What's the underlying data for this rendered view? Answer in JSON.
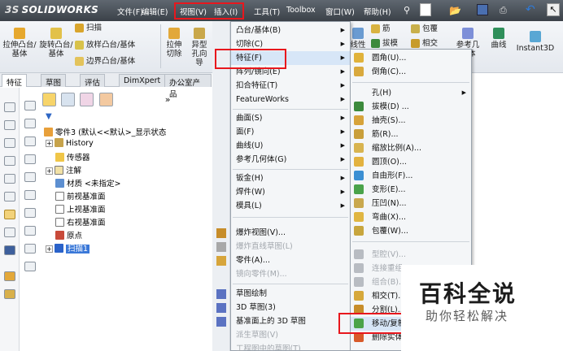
{
  "app": {
    "logo_prefix": "3S",
    "logo_name": "SOLIDWORKS"
  },
  "menubar": {
    "items": [
      "文件(F)",
      "编辑(E)",
      "视图(V)",
      "插入(I)",
      "工具(T)",
      "Toolbox",
      "窗口(W)",
      "帮助(H)"
    ]
  },
  "ribbon": {
    "extrude_boss": "拉伸凸台/基体",
    "revolve_boss": "旋转凸台/基体",
    "sweep": "扫描",
    "loft": "放样凸台/基体",
    "boundary": "边界凸台/基体",
    "extrude_cut": "拉伸切除",
    "hole_wizard": "异型孔向导",
    "linear_pattern": "线性阵列",
    "rib": "筋",
    "wrap": "包覆",
    "draft": "拔模",
    "intersect": "相交",
    "ref_geometry": "参考几何体",
    "curves": "曲线",
    "instant3d": "Instant3D"
  },
  "tabs": [
    "特征",
    "草图",
    "评估",
    "DimXpert",
    "办公室产品"
  ],
  "tree": {
    "part": "零件3 (默认<<默认>_显示状态",
    "history": "History",
    "sensors": "传感器",
    "annotations": "注解",
    "material": "材质 <未指定>",
    "front_plane": "前视基准面",
    "top_plane": "上视基准面",
    "right_plane": "右视基准面",
    "origin": "原点",
    "sweep1": "扫描1"
  },
  "insert_menu": {
    "items": [
      {
        "label": "凸台/基体(B)",
        "sub": true,
        "dis": false
      },
      {
        "label": "切除(C)",
        "sub": true,
        "dis": false
      },
      {
        "label": "特征(F)",
        "sub": true,
        "dis": false,
        "hl": true
      },
      {
        "label": "阵列/镜向(E)",
        "sub": true,
        "dis": false
      },
      {
        "label": "扣合特征(T)",
        "sub": true,
        "dis": false
      },
      {
        "label": "FeatureWorks",
        "sub": true,
        "dis": false
      },
      {
        "label": "曲面(S)",
        "sub": true,
        "dis": false
      },
      {
        "label": "面(F)",
        "sub": true,
        "dis": false
      },
      {
        "label": "曲线(U)",
        "sub": true,
        "dis": false
      },
      {
        "label": "参考几何体(G)",
        "sub": true,
        "dis": false
      },
      {
        "label": "钣金(H)",
        "sub": true,
        "dis": false
      },
      {
        "label": "焊件(W)",
        "sub": true,
        "dis": false
      },
      {
        "label": "模具(L)",
        "sub": true,
        "dis": false
      },
      {
        "label": "爆炸视图(V)...",
        "sub": false,
        "dis": false
      },
      {
        "label": "爆炸直线草图(L)",
        "sub": false,
        "dis": true
      },
      {
        "label": "零件(A)...",
        "sub": false,
        "dis": false
      },
      {
        "label": "镜向零件(M)...",
        "sub": false,
        "dis": true
      },
      {
        "label": "草图绘制",
        "sub": false,
        "dis": false
      },
      {
        "label": "3D 草图(3)",
        "sub": false,
        "dis": false
      },
      {
        "label": "基准面上的 3D 草图",
        "sub": false,
        "dis": false
      },
      {
        "label": "派生草图(V)",
        "sub": false,
        "dis": true
      },
      {
        "label": "工程图中的草图(T)",
        "sub": false,
        "dis": true
      }
    ]
  },
  "feature_menu": {
    "items": [
      {
        "label": "圆角(U)...",
        "sub": false,
        "dis": false
      },
      {
        "label": "倒角(C)...",
        "sub": false,
        "dis": false
      },
      {
        "label": "孔(H)",
        "sub": true,
        "dis": false
      },
      {
        "label": "拔模(D) ...",
        "sub": false,
        "dis": false
      },
      {
        "label": "抽壳(S)...",
        "sub": false,
        "dis": false
      },
      {
        "label": "筋(R)...",
        "sub": false,
        "dis": false
      },
      {
        "label": "缩放比例(A)...",
        "sub": false,
        "dis": false
      },
      {
        "label": "圆顶(O)...",
        "sub": false,
        "dis": false
      },
      {
        "label": "自由形(F)...",
        "sub": false,
        "dis": false
      },
      {
        "label": "变形(E)...",
        "sub": false,
        "dis": false
      },
      {
        "label": "压凹(N)...",
        "sub": false,
        "dis": false
      },
      {
        "label": "弯曲(X)...",
        "sub": false,
        "dis": false
      },
      {
        "label": "包覆(W)...",
        "sub": false,
        "dis": false
      },
      {
        "label": "型腔(V)...",
        "sub": false,
        "dis": true
      },
      {
        "label": "连接重组",
        "sub": false,
        "dis": true
      },
      {
        "label": "组合(B)...",
        "sub": false,
        "dis": true
      },
      {
        "label": "相交(T)...",
        "sub": false,
        "dis": false
      },
      {
        "label": "分割(L)...",
        "sub": false,
        "dis": false
      },
      {
        "label": "移动/复制",
        "sub": false,
        "dis": false,
        "hl": true
      },
      {
        "label": "删除实体(Y)...",
        "sub": false,
        "dis": false
      }
    ]
  },
  "watermark": {
    "title": "百科全说",
    "subtitle": "助你轻松解决"
  },
  "colors": {
    "highlight_box": "#e8171d",
    "menu_bg": "#f4f6f8",
    "menu_hover": "#d7e6f7"
  }
}
